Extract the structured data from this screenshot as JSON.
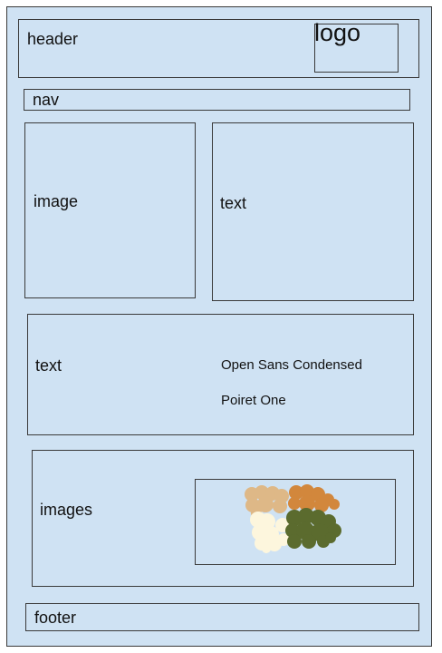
{
  "header": {
    "label": "header",
    "logo": "logo"
  },
  "nav": {
    "label": "nav"
  },
  "row1": {
    "image_label": "image",
    "text_label": "text"
  },
  "row2": {
    "text_label": "text",
    "fonts": [
      "Open Sans Condensed",
      "Poiret One"
    ]
  },
  "row3": {
    "images_label": "images"
  },
  "palette": {
    "colors": [
      "#deb887",
      "#d2873c",
      "#fdf6dd",
      "#5b6b2e"
    ]
  },
  "footer": {
    "label": "footer"
  }
}
